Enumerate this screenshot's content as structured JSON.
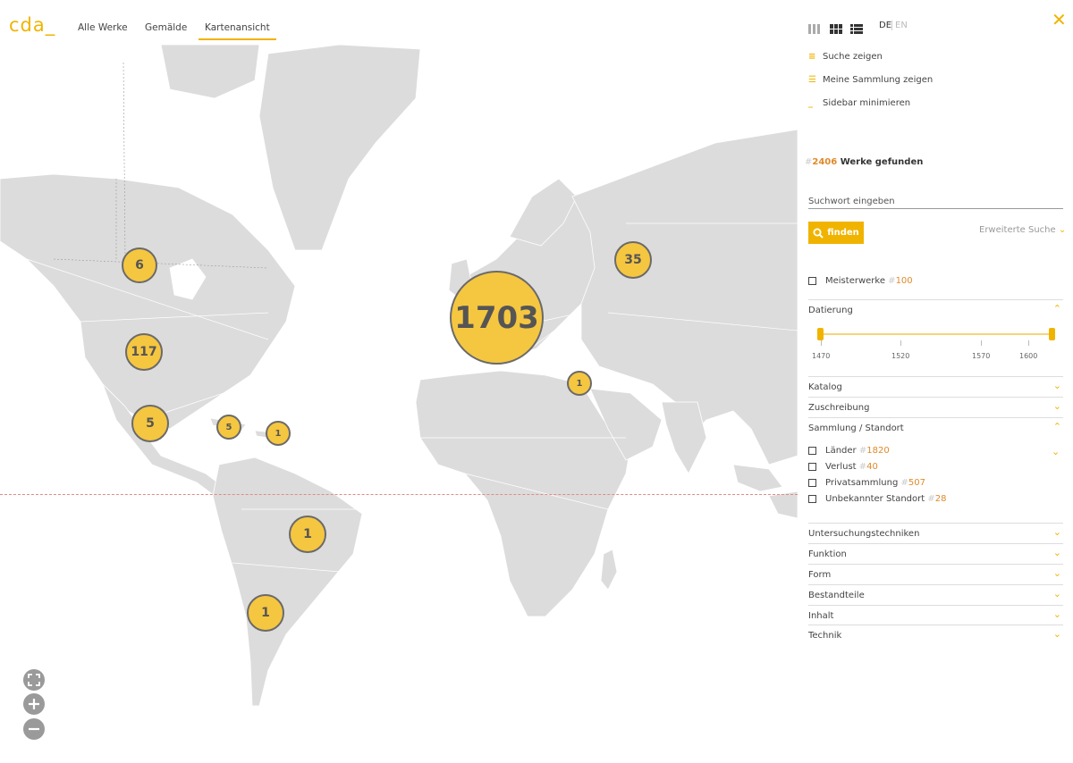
{
  "app": {
    "logo": "cda_"
  },
  "nav": [
    {
      "label": "Alle Werke"
    },
    {
      "label": "Gemälde"
    },
    {
      "label": "Kartenansicht"
    }
  ],
  "lang": {
    "de": "DE",
    "en": "EN"
  },
  "sidebar": {
    "actions": [
      {
        "label": "Suche zeigen",
        "icon": "search-list-icon"
      },
      {
        "label": "Meine Sammlung zeigen",
        "icon": "list-icon"
      },
      {
        "label": "Sidebar minimieren",
        "icon": "minimize-icon"
      }
    ],
    "found_hash": "#",
    "found_count": "2406",
    "found_label": "Werke gefunden",
    "search_placeholder": "Suchwort eingeben",
    "search_button": "finden",
    "advanced_label": "Erweiterte Suche",
    "masterworks": {
      "label": "Meisterwerke",
      "hash": "#",
      "count": "100"
    },
    "datierung": {
      "label": "Datierung",
      "min_year": 1470,
      "max_year": 1630,
      "tick_labels": [
        "1470",
        "1520",
        "1570",
        "1600"
      ]
    },
    "sections": [
      {
        "label": "Katalog"
      },
      {
        "label": "Zuschreibung"
      },
      {
        "label": "Sammlung / Standort"
      }
    ],
    "standort_items": [
      {
        "label": "Länder",
        "hash": "#",
        "count": "1820"
      },
      {
        "label": "Verlust",
        "hash": "#",
        "count": "40"
      },
      {
        "label": "Privatsammlung",
        "hash": "#",
        "count": "507"
      },
      {
        "label": "Unbekannter Standort",
        "hash": "#",
        "count": "28"
      }
    ],
    "more_sections": [
      {
        "label": "Untersuchungstechniken"
      },
      {
        "label": "Funktion"
      },
      {
        "label": "Form"
      },
      {
        "label": "Bestandteile"
      },
      {
        "label": "Inhalt"
      },
      {
        "label": "Technik"
      }
    ]
  },
  "map": {
    "clusters": [
      {
        "label": "1703"
      },
      {
        "label": "117"
      },
      {
        "label": "35"
      },
      {
        "label": "6"
      },
      {
        "label": "5"
      },
      {
        "label": "5"
      },
      {
        "label": "1"
      },
      {
        "label": "1"
      },
      {
        "label": "1"
      },
      {
        "label": "1"
      }
    ]
  },
  "colors": {
    "accent": "#f0b400",
    "cluster": "#f5c640",
    "count": "#e08a2a",
    "land": "#dcdcdc"
  }
}
